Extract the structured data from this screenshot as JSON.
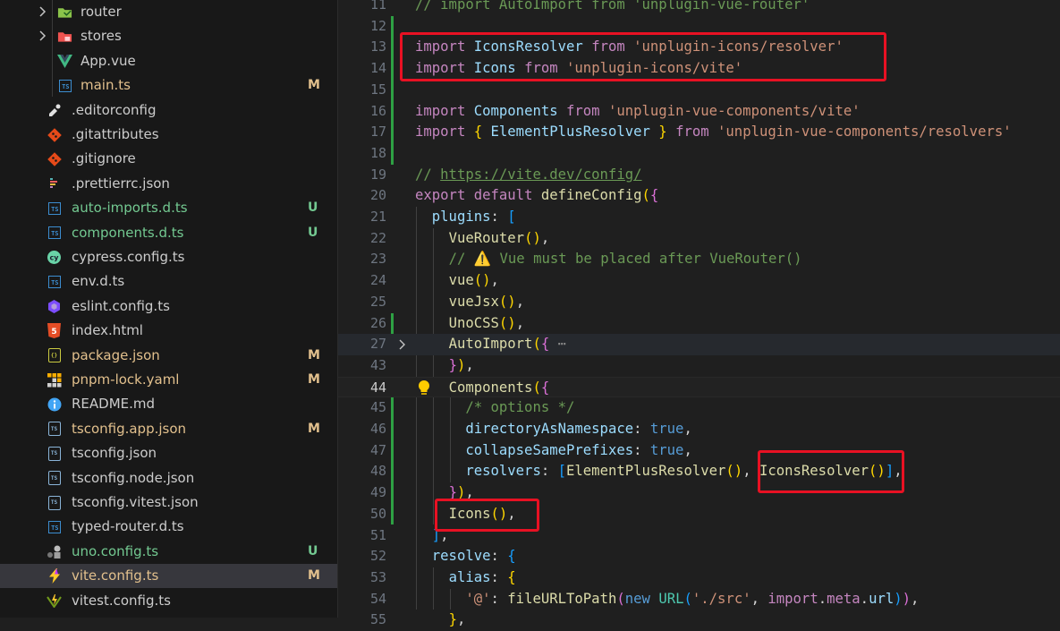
{
  "explorer": {
    "files": [
      {
        "name": "router",
        "icon": "router-folder-icon",
        "folder": true,
        "level": 2,
        "status": ""
      },
      {
        "name": "stores",
        "icon": "stores-folder-icon",
        "folder": true,
        "level": 2,
        "status": ""
      },
      {
        "name": "App.vue",
        "icon": "vue-icon",
        "level": 2,
        "status": ""
      },
      {
        "name": "main.ts",
        "icon": "ts-icon",
        "level": 2,
        "status": "M"
      },
      {
        "name": ".editorconfig",
        "icon": "editorconfig-icon",
        "level": 1,
        "status": ""
      },
      {
        "name": ".gitattributes",
        "icon": "git-icon",
        "level": 1,
        "status": ""
      },
      {
        "name": ".gitignore",
        "icon": "git-icon",
        "level": 1,
        "status": ""
      },
      {
        "name": ".prettierrc.json",
        "icon": "prettier-icon",
        "level": 1,
        "status": ""
      },
      {
        "name": "auto-imports.d.ts",
        "icon": "ts-icon",
        "level": 1,
        "status": "U"
      },
      {
        "name": "components.d.ts",
        "icon": "ts-icon",
        "level": 1,
        "status": "U"
      },
      {
        "name": "cypress.config.ts",
        "icon": "cypress-icon",
        "level": 1,
        "status": ""
      },
      {
        "name": "env.d.ts",
        "icon": "ts-icon",
        "level": 1,
        "status": ""
      },
      {
        "name": "eslint.config.ts",
        "icon": "eslint-icon",
        "level": 1,
        "status": ""
      },
      {
        "name": "index.html",
        "icon": "html-icon",
        "level": 1,
        "status": ""
      },
      {
        "name": "package.json",
        "icon": "npm-json-icon",
        "level": 1,
        "status": "M"
      },
      {
        "name": "pnpm-lock.yaml",
        "icon": "pnpm-icon",
        "level": 1,
        "status": "M"
      },
      {
        "name": "README.md",
        "icon": "info-icon",
        "level": 1,
        "status": ""
      },
      {
        "name": "tsconfig.app.json",
        "icon": "tsconfig-icon",
        "level": 1,
        "status": "M"
      },
      {
        "name": "tsconfig.json",
        "icon": "tsconfig-icon",
        "level": 1,
        "status": ""
      },
      {
        "name": "tsconfig.node.json",
        "icon": "tsconfig-icon",
        "level": 1,
        "status": ""
      },
      {
        "name": "tsconfig.vitest.json",
        "icon": "tsconfig-icon",
        "level": 1,
        "status": ""
      },
      {
        "name": "typed-router.d.ts",
        "icon": "ts-icon",
        "level": 1,
        "status": ""
      },
      {
        "name": "uno.config.ts",
        "icon": "unocss-icon",
        "level": 1,
        "status": "U"
      },
      {
        "name": "vite.config.ts",
        "icon": "vite-icon",
        "level": 1,
        "status": "M",
        "selected": true
      },
      {
        "name": "vitest.config.ts",
        "icon": "vitest-icon",
        "level": 1,
        "status": ""
      }
    ]
  },
  "editor": {
    "current_line": "44",
    "lines": [
      {
        "n": "11",
        "tokens": [
          [
            "cmt",
            "// import AutoImport from 'unplugin-vue-router'"
          ]
        ]
      },
      {
        "n": "12",
        "tokens": []
      },
      {
        "n": "13",
        "tokens": [
          [
            "kw",
            "import"
          ],
          [
            "pl",
            " "
          ],
          [
            "prop",
            "IconsResolver"
          ],
          [
            "pl",
            " "
          ],
          [
            "kw",
            "from"
          ],
          [
            "pl",
            " "
          ],
          [
            "str",
            "'unplugin-icons/resolver'"
          ]
        ]
      },
      {
        "n": "14",
        "tokens": [
          [
            "kw",
            "import"
          ],
          [
            "pl",
            " "
          ],
          [
            "prop",
            "Icons"
          ],
          [
            "pl",
            " "
          ],
          [
            "kw",
            "from"
          ],
          [
            "pl",
            " "
          ],
          [
            "str",
            "'unplugin-icons/vite'"
          ]
        ]
      },
      {
        "n": "15",
        "tokens": []
      },
      {
        "n": "16",
        "tokens": [
          [
            "kw",
            "import"
          ],
          [
            "pl",
            " "
          ],
          [
            "prop",
            "Components"
          ],
          [
            "pl",
            " "
          ],
          [
            "kw",
            "from"
          ],
          [
            "pl",
            " "
          ],
          [
            "str",
            "'unplugin-vue-components/vite'"
          ]
        ]
      },
      {
        "n": "17",
        "tokens": [
          [
            "kw",
            "import"
          ],
          [
            "pl",
            " "
          ],
          [
            "b1",
            "{"
          ],
          [
            "pl",
            " "
          ],
          [
            "prop",
            "ElementPlusResolver"
          ],
          [
            "pl",
            " "
          ],
          [
            "b1",
            "}"
          ],
          [
            "pl",
            " "
          ],
          [
            "kw",
            "from"
          ],
          [
            "pl",
            " "
          ],
          [
            "str",
            "'unplugin-vue-components/resolvers'"
          ]
        ]
      },
      {
        "n": "18",
        "tokens": []
      },
      {
        "n": "19",
        "tokens": [
          [
            "cmt",
            "// "
          ],
          [
            "link",
            "https://vite.dev/config/"
          ]
        ]
      },
      {
        "n": "20",
        "tokens": [
          [
            "kw",
            "export"
          ],
          [
            "pl",
            " "
          ],
          [
            "kw",
            "default"
          ],
          [
            "pl",
            " "
          ],
          [
            "fn",
            "defineConfig"
          ],
          [
            "b1",
            "("
          ],
          [
            "b2",
            "{"
          ]
        ]
      },
      {
        "n": "21",
        "tokens": [
          [
            "pl",
            "  "
          ],
          [
            "prop",
            "plugins"
          ],
          [
            "pl",
            ": "
          ],
          [
            "b3",
            "["
          ]
        ]
      },
      {
        "n": "22",
        "tokens": [
          [
            "pl",
            "    "
          ],
          [
            "fn",
            "VueRouter"
          ],
          [
            "b1",
            "()"
          ],
          [
            "pl",
            ","
          ]
        ]
      },
      {
        "n": "23",
        "tokens": [
          [
            "pl",
            "    "
          ],
          [
            "cmt",
            "// ⚠️ Vue must be placed after VueRouter()"
          ]
        ]
      },
      {
        "n": "24",
        "tokens": [
          [
            "pl",
            "    "
          ],
          [
            "fn",
            "vue"
          ],
          [
            "b1",
            "()"
          ],
          [
            "pl",
            ","
          ]
        ]
      },
      {
        "n": "25",
        "tokens": [
          [
            "pl",
            "    "
          ],
          [
            "fn",
            "vueJsx"
          ],
          [
            "b1",
            "()"
          ],
          [
            "pl",
            ","
          ]
        ]
      },
      {
        "n": "26",
        "tokens": [
          [
            "pl",
            "    "
          ],
          [
            "fn",
            "UnoCSS"
          ],
          [
            "b1",
            "()"
          ],
          [
            "pl",
            ","
          ]
        ]
      },
      {
        "n": "27",
        "tokens": [
          [
            "pl",
            "    "
          ],
          [
            "fn",
            "AutoImport"
          ],
          [
            "b1",
            "("
          ],
          [
            "b2",
            "{"
          ],
          [
            "pl",
            " "
          ],
          [
            "ell",
            "⋯"
          ]
        ]
      },
      {
        "n": "43",
        "tokens": [
          [
            "pl",
            "    "
          ],
          [
            "b2",
            "}"
          ],
          [
            "b1",
            ")"
          ],
          [
            "pl",
            ","
          ]
        ]
      },
      {
        "n": "44",
        "tokens": [
          [
            "pl",
            "    "
          ],
          [
            "fn",
            "Components"
          ],
          [
            "b1",
            "("
          ],
          [
            "b2",
            "{"
          ]
        ]
      },
      {
        "n": "45",
        "tokens": [
          [
            "pl",
            "      "
          ],
          [
            "cmt",
            "/* options */"
          ]
        ]
      },
      {
        "n": "46",
        "tokens": [
          [
            "pl",
            "      "
          ],
          [
            "prop",
            "directoryAsNamespace"
          ],
          [
            "pl",
            ": "
          ],
          [
            "kwb",
            "true"
          ],
          [
            "pl",
            ","
          ]
        ]
      },
      {
        "n": "47",
        "tokens": [
          [
            "pl",
            "      "
          ],
          [
            "prop",
            "collapseSamePrefixes"
          ],
          [
            "pl",
            ": "
          ],
          [
            "kwb",
            "true"
          ],
          [
            "pl",
            ","
          ]
        ]
      },
      {
        "n": "48",
        "tokens": [
          [
            "pl",
            "      "
          ],
          [
            "prop",
            "resolvers"
          ],
          [
            "pl",
            ": "
          ],
          [
            "b3",
            "["
          ],
          [
            "fn",
            "ElementPlusResolver"
          ],
          [
            "b1",
            "()"
          ],
          [
            "pl",
            ", "
          ],
          [
            "fn",
            "IconsResolver"
          ],
          [
            "b1",
            "()"
          ],
          [
            "b3",
            "]"
          ],
          [
            "pl",
            ","
          ]
        ]
      },
      {
        "n": "49",
        "tokens": [
          [
            "pl",
            "    "
          ],
          [
            "b2",
            "}"
          ],
          [
            "b1",
            ")"
          ],
          [
            "pl",
            ","
          ]
        ]
      },
      {
        "n": "50",
        "tokens": [
          [
            "pl",
            "    "
          ],
          [
            "fn",
            "Icons"
          ],
          [
            "b1",
            "()"
          ],
          [
            "pl",
            ","
          ]
        ]
      },
      {
        "n": "51",
        "tokens": [
          [
            "pl",
            "  "
          ],
          [
            "b3",
            "]"
          ],
          [
            "pl",
            ","
          ]
        ]
      },
      {
        "n": "52",
        "tokens": [
          [
            "pl",
            "  "
          ],
          [
            "prop",
            "resolve"
          ],
          [
            "pl",
            ": "
          ],
          [
            "b3",
            "{"
          ]
        ]
      },
      {
        "n": "53",
        "tokens": [
          [
            "pl",
            "    "
          ],
          [
            "prop",
            "alias"
          ],
          [
            "pl",
            ": "
          ],
          [
            "b1",
            "{"
          ]
        ]
      },
      {
        "n": "54",
        "tokens": [
          [
            "pl",
            "      "
          ],
          [
            "str",
            "'@'"
          ],
          [
            "pl",
            ": "
          ],
          [
            "fn",
            "fileURLToPath"
          ],
          [
            "b2",
            "("
          ],
          [
            "kwb",
            "new"
          ],
          [
            "pl",
            " "
          ],
          [
            "cls",
            "URL"
          ],
          [
            "b3",
            "("
          ],
          [
            "str",
            "'./src'"
          ],
          [
            "pl",
            ", "
          ],
          [
            "kw",
            "import"
          ],
          [
            "pl",
            "."
          ],
          [
            "kw",
            "meta"
          ],
          [
            "pl",
            "."
          ],
          [
            "prop",
            "url"
          ],
          [
            "b3",
            ")"
          ],
          [
            "b2",
            ")"
          ],
          [
            "pl",
            ","
          ]
        ]
      },
      {
        "n": "55",
        "tokens": [
          [
            "pl",
            "    "
          ],
          [
            "b1",
            "}"
          ],
          [
            "pl",
            ","
          ]
        ]
      }
    ]
  },
  "colors": {
    "highlight_box": "#e81123",
    "git_added_bar": "#2ea043",
    "modified": "#e2c08d",
    "untracked": "#73c991"
  }
}
